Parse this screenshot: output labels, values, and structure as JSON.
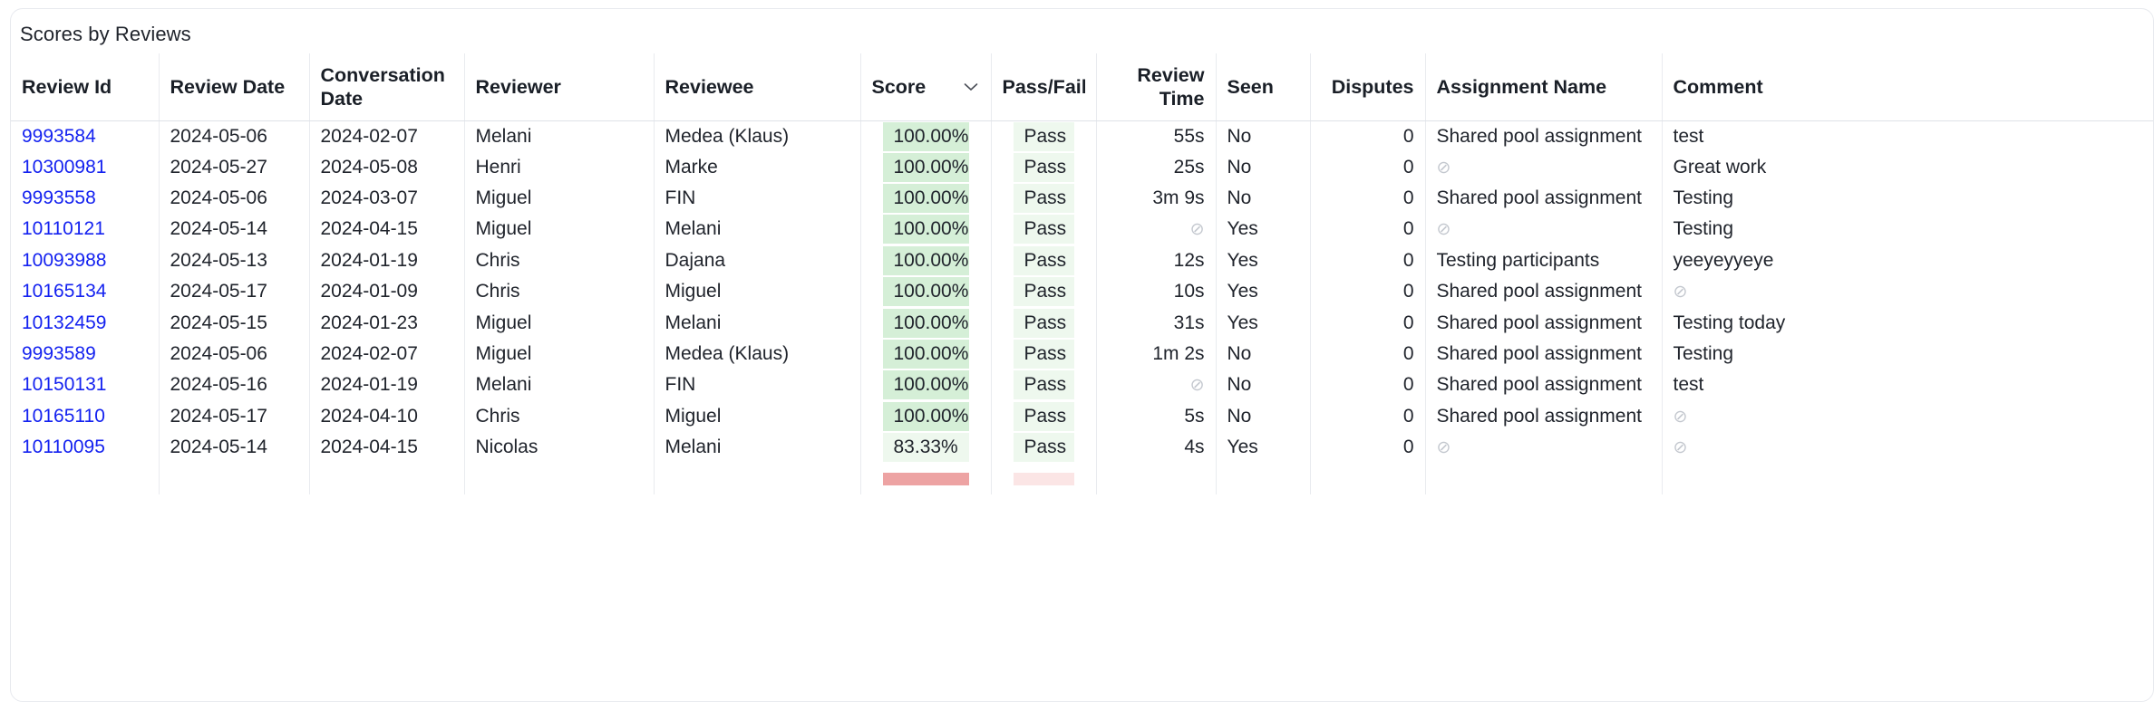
{
  "card": {
    "title": "Scores by Reviews"
  },
  "table": {
    "columns": [
      {
        "key": "review_id",
        "label": "Review Id",
        "align": "left",
        "sortable": false
      },
      {
        "key": "review_date",
        "label": "Review Date",
        "align": "left",
        "sortable": false
      },
      {
        "key": "conversation_date",
        "label": "Conversation Date",
        "align": "left",
        "sortable": false
      },
      {
        "key": "reviewer",
        "label": "Reviewer",
        "align": "left",
        "sortable": false
      },
      {
        "key": "reviewee",
        "label": "Reviewee",
        "align": "left",
        "sortable": false
      },
      {
        "key": "score",
        "label": "Score",
        "align": "left",
        "sortable": true,
        "sort_icon": "chevron-down-icon"
      },
      {
        "key": "pass_fail",
        "label": "Pass/Fail",
        "align": "left",
        "sortable": false
      },
      {
        "key": "review_time",
        "label": "Review Time",
        "align": "right",
        "sortable": false
      },
      {
        "key": "seen",
        "label": "Seen",
        "align": "left",
        "sortable": false
      },
      {
        "key": "disputes",
        "label": "Disputes",
        "align": "right",
        "sortable": false
      },
      {
        "key": "assignment_name",
        "label": "Assignment Name",
        "align": "left",
        "sortable": false
      },
      {
        "key": "comment",
        "label": "Comment",
        "align": "left",
        "sortable": false
      }
    ],
    "empty_glyph": "⊘",
    "rows": [
      {
        "review_id": "9993584",
        "review_date": "2024-05-06",
        "conversation_date": "2024-02-07",
        "reviewer": "Melani",
        "reviewee": "Medea (Klaus)",
        "score": "100.00%",
        "score_level": "full",
        "pass_fail": "Pass",
        "review_time": "55s",
        "seen": "No",
        "disputes": "0",
        "assignment_name": "Shared pool assignment",
        "comment": "test"
      },
      {
        "review_id": "10300981",
        "review_date": "2024-05-27",
        "conversation_date": "2024-05-08",
        "reviewer": "Henri",
        "reviewee": "Marke",
        "score": "100.00%",
        "score_level": "full",
        "pass_fail": "Pass",
        "review_time": "25s",
        "seen": "No",
        "disputes": "0",
        "assignment_name": null,
        "comment": "Great work"
      },
      {
        "review_id": "9993558",
        "review_date": "2024-05-06",
        "conversation_date": "2024-03-07",
        "reviewer": "Miguel",
        "reviewee": "FIN",
        "score": "100.00%",
        "score_level": "full",
        "pass_fail": "Pass",
        "review_time": "3m 9s",
        "seen": "No",
        "disputes": "0",
        "assignment_name": "Shared pool assignment",
        "comment": "Testing"
      },
      {
        "review_id": "10110121",
        "review_date": "2024-05-14",
        "conversation_date": "2024-04-15",
        "reviewer": "Miguel",
        "reviewee": "Melani",
        "score": "100.00%",
        "score_level": "full",
        "pass_fail": "Pass",
        "review_time": null,
        "seen": "Yes",
        "disputes": "0",
        "assignment_name": null,
        "comment": "Testing"
      },
      {
        "review_id": "10093988",
        "review_date": "2024-05-13",
        "conversation_date": "2024-01-19",
        "reviewer": "Chris",
        "reviewee": "Dajana",
        "score": "100.00%",
        "score_level": "full",
        "pass_fail": "Pass",
        "review_time": "12s",
        "seen": "Yes",
        "disputes": "0",
        "assignment_name": "Testing participants",
        "comment": "yeeyeyyeye"
      },
      {
        "review_id": "10165134",
        "review_date": "2024-05-17",
        "conversation_date": "2024-01-09",
        "reviewer": "Chris",
        "reviewee": "Miguel",
        "score": "100.00%",
        "score_level": "full",
        "pass_fail": "Pass",
        "review_time": "10s",
        "seen": "Yes",
        "disputes": "0",
        "assignment_name": "Shared pool assignment",
        "comment": null
      },
      {
        "review_id": "10132459",
        "review_date": "2024-05-15",
        "conversation_date": "2024-01-23",
        "reviewer": "Miguel",
        "reviewee": "Melani",
        "score": "100.00%",
        "score_level": "full",
        "pass_fail": "Pass",
        "review_time": "31s",
        "seen": "Yes",
        "disputes": "0",
        "assignment_name": "Shared pool assignment",
        "comment": "Testing today"
      },
      {
        "review_id": "9993589",
        "review_date": "2024-05-06",
        "conversation_date": "2024-02-07",
        "reviewer": "Miguel",
        "reviewee": "Medea (Klaus)",
        "score": "100.00%",
        "score_level": "full",
        "pass_fail": "Pass",
        "review_time": "1m 2s",
        "seen": "No",
        "disputes": "0",
        "assignment_name": "Shared pool assignment",
        "comment": "Testing"
      },
      {
        "review_id": "10150131",
        "review_date": "2024-05-16",
        "conversation_date": "2024-01-19",
        "reviewer": "Melani",
        "reviewee": "FIN",
        "score": "100.00%",
        "score_level": "full",
        "pass_fail": "Pass",
        "review_time": null,
        "seen": "No",
        "disputes": "0",
        "assignment_name": "Shared pool assignment",
        "comment": "test"
      },
      {
        "review_id": "10165110",
        "review_date": "2024-05-17",
        "conversation_date": "2024-04-10",
        "reviewer": "Chris",
        "reviewee": "Miguel",
        "score": "100.00%",
        "score_level": "full",
        "pass_fail": "Pass",
        "review_time": "5s",
        "seen": "No",
        "disputes": "0",
        "assignment_name": "Shared pool assignment",
        "comment": null
      },
      {
        "review_id": "10110095",
        "review_date": "2024-05-14",
        "conversation_date": "2024-04-15",
        "reviewer": "Nicolas",
        "reviewee": "Melani",
        "score": "83.33%",
        "score_level": "mid",
        "pass_fail": "Pass",
        "review_time": "4s",
        "seen": "Yes",
        "disputes": "0",
        "assignment_name": null,
        "comment": null
      }
    ]
  },
  "colors": {
    "link": "#1422f0",
    "score_full_bg": "#d5efd7",
    "score_mid_bg": "#eef8ee",
    "pass_bg": "#eef8ee",
    "fail_bg": "#eda3a3",
    "empty_glyph": "#c3c7ce",
    "card_border": "#e7e9ee"
  }
}
